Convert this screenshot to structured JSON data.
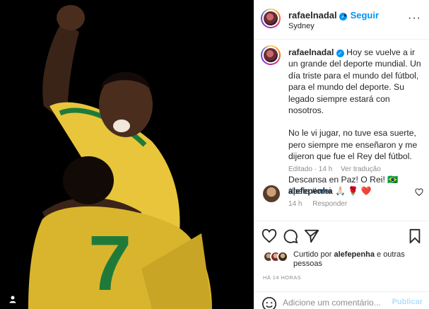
{
  "post": {
    "image_alt": "Pelé celebrating in a yellow Brazil jersey, arm raised, embracing a teammate wearing number 7",
    "jersey_number": "7"
  },
  "header": {
    "username": "rafaelnadal",
    "separator": "•",
    "follow_label": "Seguir",
    "location": "Sydney",
    "more_icon": "more-horizontal-icon"
  },
  "caption": {
    "username": "rafaelnadal",
    "paragraph1": "Hoy se vuelve a ir un grande del deporte mundial. Un día triste para el mundo del fútbol, para el mundo del deporte. Su legado siempre estará con nosotros.",
    "paragraph2": "No le vi jugar, no tuve esa suerte, pero siempre me enseñaron y me dijeron que fue el Rey del fútbol.",
    "paragraph3": "Descansa en Paz! O Rei! 🇧🇷",
    "hashtag1": "#pele",
    "hashtag2": "#orei",
    "edited_label": "Editado · 14 h",
    "translate_label": "Ver tradução"
  },
  "comment": {
    "username": "alefepenha",
    "text": "🙏🏻 🌹 ❤️",
    "time": "14 h",
    "reply_label": "Responder"
  },
  "likes": {
    "prefix": "Curtido por",
    "username": "alefepenha",
    "suffix": "e outras pessoas"
  },
  "timestamp": "HÁ 14 HORAS",
  "add_comment": {
    "placeholder": "Adicione um comentário...",
    "publish_label": "Publicar"
  },
  "colors": {
    "accent": "#0095f6",
    "verified": "#0095f6",
    "publish_disabled": "#b2dffc",
    "secondary_text": "#8e8e8e",
    "heart_red": "#ed4956"
  }
}
